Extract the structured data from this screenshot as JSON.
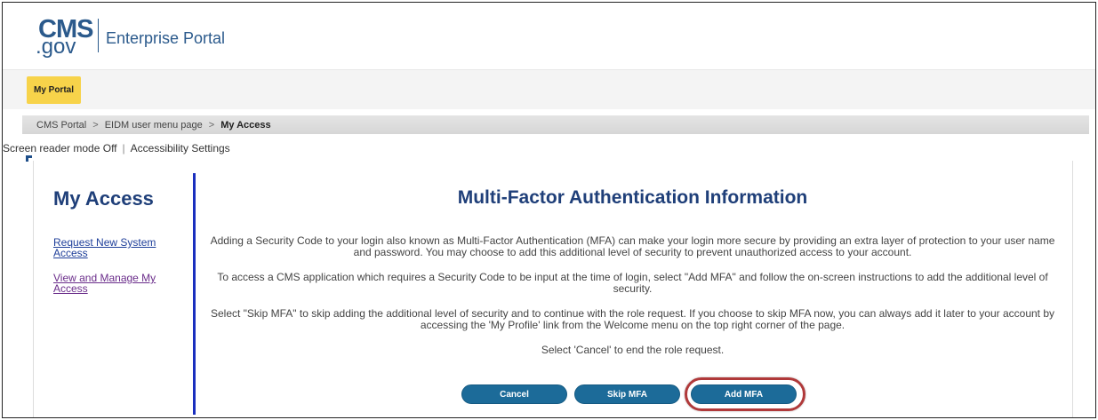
{
  "header": {
    "logo_cms": "CMS",
    "logo_gov": ".gov",
    "portal_name": "Enterprise Portal"
  },
  "nav": {
    "my_portal_label": "My Portal"
  },
  "breadcrumb": {
    "items": [
      "CMS Portal",
      "EIDM user menu page",
      "My Access"
    ],
    "separator": ">"
  },
  "utility": {
    "screen_reader": "Screen reader mode Off",
    "divider": "|",
    "accessibility": "Accessibility Settings"
  },
  "sidebar": {
    "title": "My Access",
    "links": [
      {
        "label": "Request New System Access"
      },
      {
        "label": "View and Manage My Access"
      }
    ]
  },
  "main": {
    "title": "Multi-Factor Authentication Information",
    "paragraphs": [
      "Adding a Security Code to your login also known as Multi-Factor Authentication (MFA) can make your login more secure by providing an extra layer of protection to your user name and password. You may choose to add this additional level of security to prevent unauthorized access to your account.",
      "To access a CMS application which requires a Security Code to be input at the time of login, select \"Add MFA\" and follow the on-screen instructions to add the additional level of security.",
      "Select \"Skip MFA\" to skip adding the additional level of security and to continue with the role request. If you choose to skip MFA now, you can always add it later to your account by accessing the 'My Profile' link from the Welcome menu on the top right corner of the page.",
      "Select 'Cancel' to end the role request."
    ]
  },
  "buttons": {
    "cancel": "Cancel",
    "skip": "Skip MFA",
    "add": "Add MFA"
  },
  "colors": {
    "brand_blue": "#2b5a8c",
    "heading_blue": "#1f3f79",
    "button_blue": "#1c6b99",
    "tab_yellow": "#f7d34a",
    "highlight_red": "#b0393a"
  }
}
